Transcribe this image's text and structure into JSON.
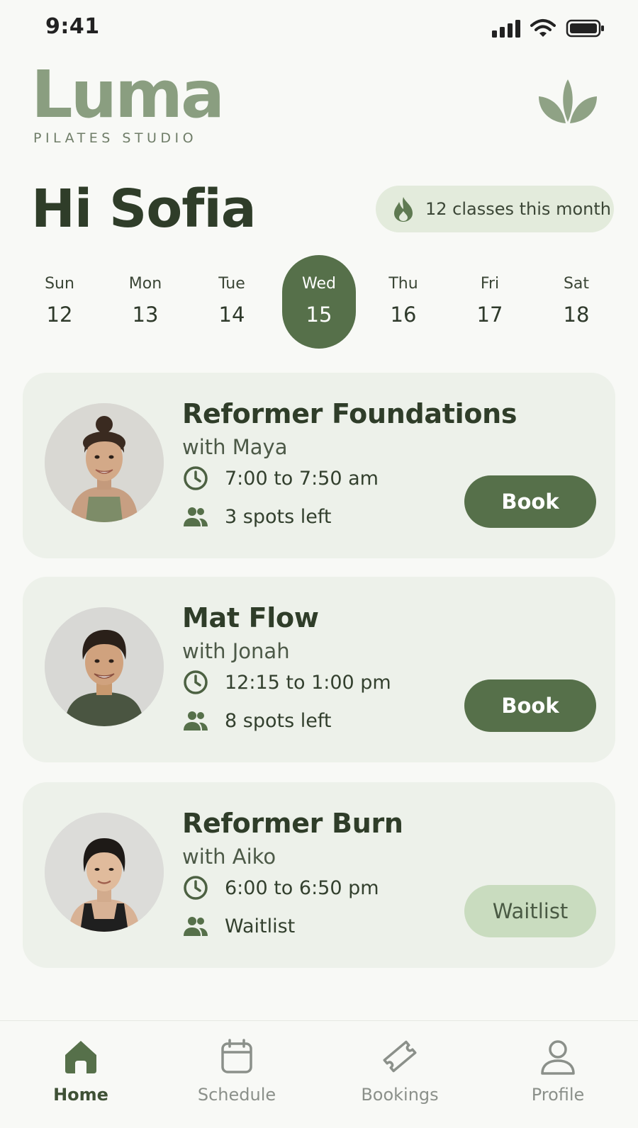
{
  "status_bar": {
    "time": "9:41"
  },
  "brand": {
    "name": "Luma",
    "tagline": "PILATES STUDIO"
  },
  "greeting": "Hi Sofia",
  "streak": {
    "text": "12 classes this month",
    "icon": "flame-icon"
  },
  "week": [
    {
      "day": "Sun",
      "date": "12",
      "selected": false
    },
    {
      "day": "Mon",
      "date": "13",
      "selected": false
    },
    {
      "day": "Tue",
      "date": "14",
      "selected": false
    },
    {
      "day": "Wed",
      "date": "15",
      "selected": true
    },
    {
      "day": "Thu",
      "date": "16",
      "selected": false
    },
    {
      "day": "Fri",
      "date": "17",
      "selected": false
    },
    {
      "day": "Sat",
      "date": "18",
      "selected": false
    }
  ],
  "classes": [
    {
      "title": "Reformer Foundations",
      "instructor": "with Maya",
      "time": "7:00 to 7:50 am",
      "spots": "3 spots left",
      "action": "Book"
    },
    {
      "title": "Mat Flow",
      "instructor": "with Jonah",
      "time": "12:15 to 1:00 pm",
      "spots": "8 spots left",
      "action": "Book"
    },
    {
      "title": "Reformer Burn",
      "instructor": "with Aiko",
      "time": "6:00 to 6:50 pm",
      "spots": "Waitlist",
      "action": "Waitlist"
    }
  ],
  "tabs": [
    {
      "label": "Home",
      "icon": "home-icon",
      "active": true
    },
    {
      "label": "Schedule",
      "icon": "calendar-icon",
      "active": false
    },
    {
      "label": "Bookings",
      "icon": "ticket-icon",
      "active": false
    },
    {
      "label": "Profile",
      "icon": "profile-icon",
      "active": false
    }
  ],
  "colors": {
    "accent": "#56704a",
    "card": "#edf1ea",
    "waitlist": "#c9dcbf",
    "background": "#f8f9f6"
  }
}
